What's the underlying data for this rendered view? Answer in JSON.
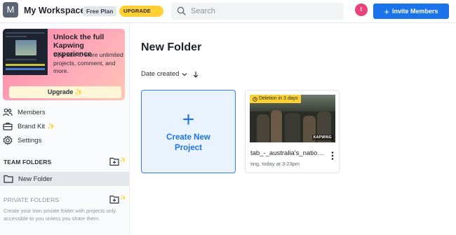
{
  "topbar": {
    "workspace_initial": "M",
    "workspace_name": "My Workspace",
    "plan_badge": "Free Plan",
    "upgrade_label": "UPGRADE ✨",
    "search_placeholder": "Search",
    "user_initial": "t",
    "invite_label": "Invite Members"
  },
  "sidebar": {
    "promo": {
      "title": "Unlock the full Kapwing experience",
      "body": "Upgrade to store unlimited projects, comment, and more.",
      "button": "Upgrade ✨"
    },
    "nav": [
      {
        "label": "Members",
        "icon": "members-icon"
      },
      {
        "label": "Brand Kit",
        "icon": "brand-kit-icon"
      },
      {
        "label": "Settings",
        "icon": "gear-icon"
      }
    ],
    "team_folders_header": "TEAM FOLDERS",
    "team_folders": [
      {
        "label": "New Folder",
        "active": true
      }
    ],
    "private_folders_header": "PRIVATE FOLDERS",
    "private_hint": "Create your own private folder with projects only accessible to you unless you share them."
  },
  "main": {
    "title": "New Folder",
    "sort_label": "Date created",
    "create_card": {
      "plus": "+",
      "label": "Create New Project"
    },
    "projects": [
      {
        "title": "tab_-_australia's_nation...",
        "meta": "ting, today at 3:23pm",
        "deletion_tag": "Deletion in 3 days",
        "watermark": "KAPWING"
      }
    ]
  },
  "colors": {
    "primary": "#1a73e8",
    "upgrade_yellow": "#ffcf33",
    "avatar_pink": "#e6447a",
    "promo_pink": "#ff82a6",
    "active_row": "#e4e7ec"
  }
}
